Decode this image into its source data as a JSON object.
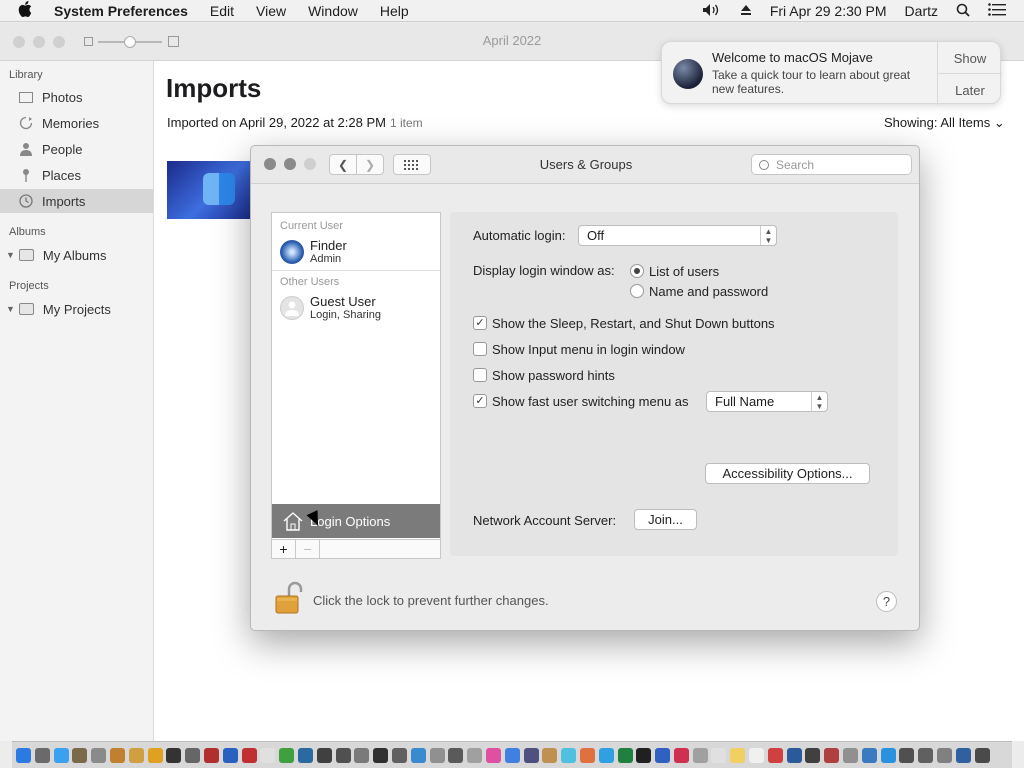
{
  "menubar": {
    "apple": "",
    "app_name": "System Preferences",
    "items": [
      "Edit",
      "View",
      "Window",
      "Help"
    ],
    "datetime": "Fri Apr 29  2:30 PM",
    "user": "Dartz"
  },
  "photos": {
    "window_title": "April 2022",
    "sidebar": {
      "library_header": "Library",
      "library_items": [
        {
          "label": "Photos",
          "icon": "photo-icon"
        },
        {
          "label": "Memories",
          "icon": "memories-icon"
        },
        {
          "label": "People",
          "icon": "person-icon"
        },
        {
          "label": "Places",
          "icon": "pin-icon"
        },
        {
          "label": "Imports",
          "icon": "clock-icon"
        }
      ],
      "albums_header": "Albums",
      "albums_item": "My Albums",
      "projects_header": "Projects",
      "projects_item": "My Projects"
    },
    "main": {
      "title": "Imports",
      "subtitle": "Imported on April 29, 2022 at 2:28 PM",
      "count": "1 item",
      "showing_label": "Showing:",
      "showing_value": "All Items"
    }
  },
  "notification": {
    "title": "Welcome to macOS Mojave",
    "body": "Take a quick tour to learn about great new features.",
    "show_label": "Show",
    "later_label": "Later"
  },
  "users_groups": {
    "title": "Users & Groups",
    "search_placeholder": "Search",
    "current_user_header": "Current User",
    "current_user": {
      "name": "Finder",
      "role": "Admin"
    },
    "other_users_header": "Other Users",
    "guest_user": {
      "name": "Guest User",
      "role": "Login, Sharing"
    },
    "login_options_label": "Login Options",
    "add_label": "+",
    "remove_label": "−",
    "automatic_login_label": "Automatic login:",
    "automatic_login_value": "Off",
    "display_login_label": "Display login window as:",
    "radio_list_label": "List of users",
    "radio_name_label": "Name and password",
    "cb_sleep_label": "Show the Sleep, Restart, and Shut Down buttons",
    "cb_sleep_checked": true,
    "cb_input_label": "Show Input menu in login window",
    "cb_input_checked": false,
    "cb_hints_label": "Show password hints",
    "cb_hints_checked": false,
    "cb_fast_label": "Show fast user switching menu as",
    "cb_fast_checked": true,
    "fast_switch_value": "Full Name",
    "accessibility_label": "Accessibility Options...",
    "network_label": "Network Account Server:",
    "join_label": "Join...",
    "lock_text": "Click the lock to prevent further changes.",
    "help_label": "?"
  },
  "dock": {
    "icon_count": 52
  }
}
